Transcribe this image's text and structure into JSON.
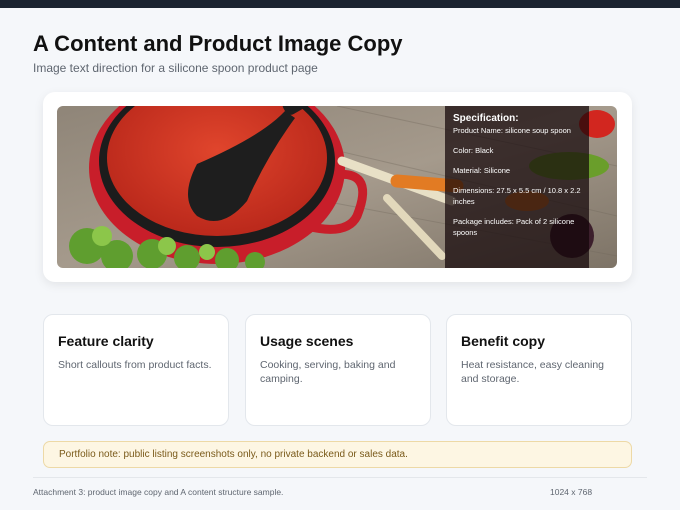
{
  "header": {
    "title": "A Content and Product Image Copy",
    "subtitle": "Image text direction for a silicone spoon product page"
  },
  "spec": {
    "title": "Specification:",
    "rows": [
      "Product Name: silicone soup spoon",
      "Color: Black",
      "Material: Silicone",
      "Dimensions: 27.5 x 5.5 cm / 10.8 x 2.2 inches",
      "Package includes: Pack of 2 silicone spoons"
    ]
  },
  "cards": [
    {
      "title": "Feature clarity",
      "text": "Short callouts from product facts."
    },
    {
      "title": "Usage scenes",
      "text": "Cooking, serving, baking and camping."
    },
    {
      "title": "Benefit copy",
      "text": "Heat resistance, easy cleaning and storage."
    }
  ],
  "note": {
    "text": "Portfolio note: public listing screenshots only, no private backend or sales data."
  },
  "footer": {
    "caption": "Attachment 3: product image copy and A content structure sample.",
    "size": "1024 x 768"
  },
  "colors": {
    "page_bg": "#f5f7fa",
    "topbar": "#1b2430",
    "note_bg": "#fdf6e3",
    "note_text": "#7a5a1a"
  }
}
